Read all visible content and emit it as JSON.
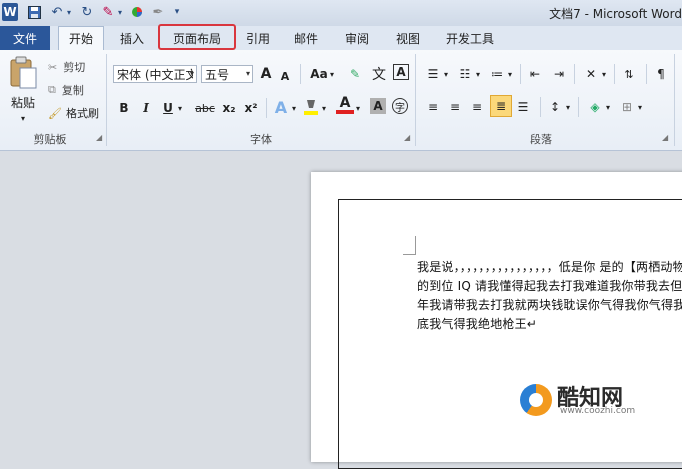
{
  "title_bar": {
    "app_letter": "W",
    "doc_title": "文档7 - Microsoft Word"
  },
  "tabs": {
    "file": "文件",
    "items": [
      "开始",
      "插入",
      "页面布局",
      "引用",
      "邮件",
      "审阅",
      "视图",
      "开发工具"
    ]
  },
  "ribbon": {
    "clipboard": {
      "paste": "粘贴",
      "cut": "剪切",
      "copy": "复制",
      "format_painter": "格式刷",
      "group_label": "剪贴板"
    },
    "font": {
      "font_name": "宋体 (中文正文)",
      "font_size": "五号",
      "grow": "A",
      "shrink": "A",
      "change_case": "Aa",
      "phonetic": "文",
      "char_border": "A",
      "bold": "B",
      "italic": "I",
      "underline": "U",
      "strike": "abc",
      "subscript": "x₂",
      "superscript": "x²",
      "text_effect": "A",
      "font_color": "A",
      "char_shading": "A",
      "enclose": "字",
      "group_label": "字体"
    },
    "paragraph": {
      "group_label": "段落"
    },
    "highlight_color": "#d9363e"
  },
  "document": {
    "lines": [
      "我是说，，，，，，，，，，，，，，，，低是你  是的【两栖动物",
      "的到位 IQ 请我懂得起我去打我难道我你带我去但子",
      "年我请带我去打我就两块钱耽误你气得我你气得我",
      "底我气得我绝地枪王↵"
    ]
  },
  "watermark": {
    "name": "酷知网",
    "url": "www.coozhi.com"
  }
}
